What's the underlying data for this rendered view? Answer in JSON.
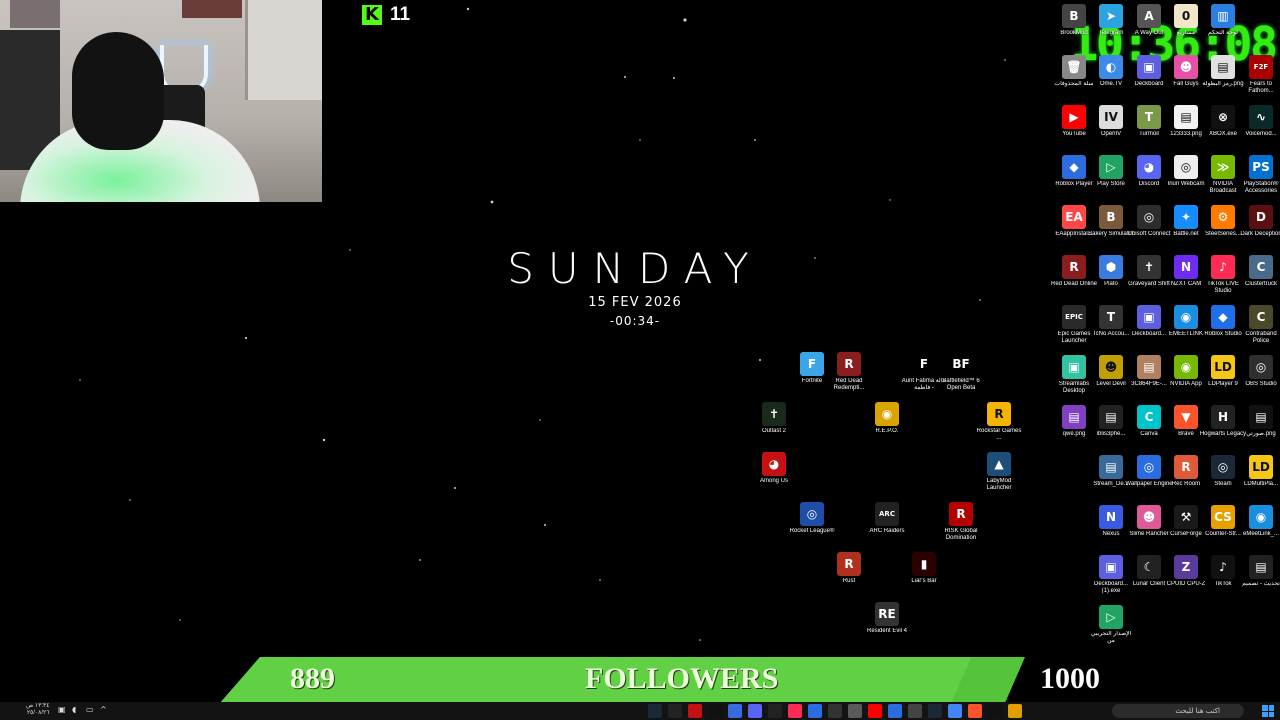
{
  "kick": {
    "count": "11"
  },
  "center": {
    "day": "SUNDAY",
    "date": "15 FEV 2026",
    "time": "-00:34-"
  },
  "clock": "10:36:08",
  "followers": {
    "current": "889",
    "label": "FOLLOWERS",
    "goal": "1000",
    "progress_percent": 88.9
  },
  "taskbar": {
    "time": "١٣:٣٤ ص",
    "date": "٢٥/٠٨/٢٦",
    "search_placeholder": "اكتب هنا للبحث"
  },
  "desktop_center_icons": [
    {
      "label": "Fortnite",
      "color": "#3aa6e8",
      "glyph": "F"
    },
    {
      "label": "Red Dead Redempti...",
      "color": "#8a1d1d",
      "glyph": "R"
    },
    {
      "label": "Aunt Fatima خالة فاطمة -",
      "color": "#000000",
      "glyph": "F"
    },
    {
      "label": "Battlefield™ 6 Open Beta",
      "color": "#000000",
      "glyph": "BF"
    },
    {
      "label": "Outlast 2",
      "color": "#1a2a1a",
      "glyph": "✝"
    },
    {
      "label": "R.E.P.O.",
      "color": "#d9a300",
      "glyph": "◉"
    },
    {
      "label": "Rockstar Games ...",
      "color": "#f4b400",
      "glyph": "R"
    },
    {
      "label": "Among Us",
      "color": "#c51111",
      "glyph": "◕"
    },
    {
      "label": "LabyMod Launcher",
      "color": "#1c4e7a",
      "glyph": "▲"
    },
    {
      "label": "Rocket League®",
      "color": "#1e4ea8",
      "glyph": "◎"
    },
    {
      "label": "ARC Raiders",
      "color": "#222222",
      "glyph": "ARC"
    },
    {
      "label": "RISK Global Domination",
      "color": "#b40000",
      "glyph": "R"
    },
    {
      "label": "Rust",
      "color": "#b0301e",
      "glyph": "R"
    },
    {
      "label": "Liar's Bar",
      "color": "#2a0000",
      "glyph": "▮"
    },
    {
      "label": "Resident Evil 4",
      "color": "#333333",
      "glyph": "RE"
    }
  ],
  "desktop_right_icons": [
    {
      "label": "BrookMod",
      "color": "#444444",
      "glyph": "B"
    },
    {
      "label": "Telegram",
      "color": "#2aa3de",
      "glyph": "➤"
    },
    {
      "label": "A Way Out",
      "color": "#555555",
      "glyph": "A"
    },
    {
      "label": "مشاريع",
      "color": "#f0e6c8",
      "glyph": "0"
    },
    {
      "label": "لوحة التحكم",
      "color": "#2b7de0",
      "glyph": "▥"
    },
    {
      "label": "سلة المحذوفات",
      "color": "#888888",
      "glyph": "🗑"
    },
    {
      "label": "Ome.TV",
      "color": "#3c8be8",
      "glyph": "◐"
    },
    {
      "label": "Deckboard",
      "color": "#5b5fe0",
      "glyph": "▣"
    },
    {
      "label": "Fall Guys",
      "color": "#e84fa6",
      "glyph": "☻"
    },
    {
      "label": "رمز البطولة.png",
      "color": "#e0e0e0",
      "glyph": "▤"
    },
    {
      "label": "Fears to Fathom...",
      "color": "#aa0000",
      "glyph": "F2F"
    },
    {
      "label": "YouTube",
      "color": "#ff0000",
      "glyph": "▶"
    },
    {
      "label": "OpenIV",
      "color": "#dddddd",
      "glyph": "IV"
    },
    {
      "label": "Turmoil",
      "color": "#7a9a4a",
      "glyph": "T"
    },
    {
      "label": "123333.png",
      "color": "#f2f2f2",
      "glyph": "▤"
    },
    {
      "label": "XBOX.exe",
      "color": "#111111",
      "glyph": "⊗"
    },
    {
      "label": "Voicemod...",
      "color": "#0a2a2a",
      "glyph": "∿"
    },
    {
      "label": "Roblox Player",
      "color": "#2d6cdf",
      "glyph": "◆"
    },
    {
      "label": "Play Store",
      "color": "#1fa463",
      "glyph": "▷"
    },
    {
      "label": "Discord",
      "color": "#5865f2",
      "glyph": "◕"
    },
    {
      "label": "Iriun Webcam",
      "color": "#eeeeee",
      "glyph": "◎"
    },
    {
      "label": "NVIDIA Broadcast",
      "color": "#76b900",
      "glyph": "≫"
    },
    {
      "label": "PlayStation® Accessories",
      "color": "#0070d1",
      "glyph": "PS"
    },
    {
      "label": "EAappInstal...",
      "color": "#ff4747",
      "glyph": "EA"
    },
    {
      "label": "Bakery Simulator",
      "color": "#7a5a3a",
      "glyph": "B"
    },
    {
      "label": "Ubisoft Connect",
      "color": "#2d2d2d",
      "glyph": "◎"
    },
    {
      "label": "Battle.net",
      "color": "#148eff",
      "glyph": "✦"
    },
    {
      "label": "SteelSeries...",
      "color": "#ff7a00",
      "glyph": "⚙"
    },
    {
      "label": "Dark Deception",
      "color": "#5a1010",
      "glyph": "D"
    },
    {
      "label": "Red Dead Online",
      "color": "#8a1d1d",
      "glyph": "R"
    },
    {
      "label": "Plato",
      "color": "#3a7be0",
      "glyph": "⬢"
    },
    {
      "label": "Graveyard Shift",
      "color": "#333333",
      "glyph": "✝"
    },
    {
      "label": "NZXT CAM",
      "color": "#6e2cf2",
      "glyph": "N"
    },
    {
      "label": "TikTok LIVE Studio",
      "color": "#fe2c55",
      "glyph": "♪"
    },
    {
      "label": "Clustertruck",
      "color": "#4a6a8a",
      "glyph": "C"
    },
    {
      "label": "Epic Games Launcher",
      "color": "#2a2a2a",
      "glyph": "EPIC"
    },
    {
      "label": "TcNo Accou...",
      "color": "#333333",
      "glyph": "T"
    },
    {
      "label": "Deckboard...",
      "color": "#5b5fe0",
      "glyph": "▣"
    },
    {
      "label": "EMEETLINK",
      "color": "#1a8fe0",
      "glyph": "◉"
    },
    {
      "label": "Roblox Studio",
      "color": "#1f6feb",
      "glyph": "◆"
    },
    {
      "label": "Contraband Police",
      "color": "#4a4a2a",
      "glyph": "C"
    },
    {
      "label": "Streamlabs Desktop",
      "color": "#31c3a2",
      "glyph": "▣"
    },
    {
      "label": "Level Devil",
      "color": "#c0a000",
      "glyph": "☻"
    },
    {
      "label": "3C864F9E-...",
      "color": "#b08060",
      "glyph": "▤"
    },
    {
      "label": "NVIDIA App",
      "color": "#76b900",
      "glyph": "◉"
    },
    {
      "label": "LDPlayer 9",
      "color": "#f5c518",
      "glyph": "LD"
    },
    {
      "label": "OBS Studio",
      "color": "#302e31",
      "glyph": "◎"
    },
    {
      "label": "qwe.png",
      "color": "#8040c0",
      "glyph": "▤"
    },
    {
      "label": "iblis3phe...",
      "color": "#222222",
      "glyph": "▤"
    },
    {
      "label": "Canva",
      "color": "#00c4cc",
      "glyph": "C"
    },
    {
      "label": "Brave",
      "color": "#fb542b",
      "glyph": "▼"
    },
    {
      "label": "Hogwarts Legacy",
      "color": "#222222",
      "glyph": "H"
    },
    {
      "label": "صورتي.png",
      "color": "#111111",
      "glyph": "▤"
    },
    {
      "label": "Stream_De...",
      "color": "#3a6a9a",
      "glyph": "▤"
    },
    {
      "label": "Wallpaper Engine",
      "color": "#2a6de0",
      "glyph": "◎"
    },
    {
      "label": "Rec Room",
      "color": "#e05a3a",
      "glyph": "R"
    },
    {
      "label": "Steam",
      "color": "#1b2838",
      "glyph": "◎"
    },
    {
      "label": "LDMultiPla...",
      "color": "#f5c518",
      "glyph": "LD"
    },
    {
      "label": "Nexus",
      "color": "#3a5ae0",
      "glyph": "N"
    },
    {
      "label": "Slime Rancher",
      "color": "#e05a9a",
      "glyph": "☻"
    },
    {
      "label": "CurseForge",
      "color": "#1a1a1a",
      "glyph": "⚒"
    },
    {
      "label": "Counter-Str...",
      "color": "#e8a000",
      "glyph": "CS"
    },
    {
      "label": "eMeetLink_...",
      "color": "#1a8fe0",
      "glyph": "◉"
    },
    {
      "label": "Deckboard... (1).exe",
      "color": "#5b5fe0",
      "glyph": "▣"
    },
    {
      "label": "Lunar Client",
      "color": "#222222",
      "glyph": "☾"
    },
    {
      "label": "CPUID CPU-Z",
      "color": "#5a3a9a",
      "glyph": "Z"
    },
    {
      "label": "TikTok",
      "color": "#111111",
      "glyph": "♪"
    },
    {
      "label": "تحديث - تصميم",
      "color": "#222222",
      "glyph": "▤"
    },
    {
      "label": "الإصدار التجريبي من",
      "color": "#1fa463",
      "glyph": "▷"
    }
  ],
  "taskbar_app_colors": [
    "#1b2838",
    "#222",
    "#c51111",
    "#111",
    "#3a6ae0",
    "#5865f2",
    "#222",
    "#fe2c55",
    "#2a6de0",
    "#333",
    "#5a5a5a",
    "#ff0000",
    "#2a6de0",
    "#444",
    "#1b2838",
    "#4285f4",
    "#fb542b",
    "#111",
    "#e0a000"
  ]
}
